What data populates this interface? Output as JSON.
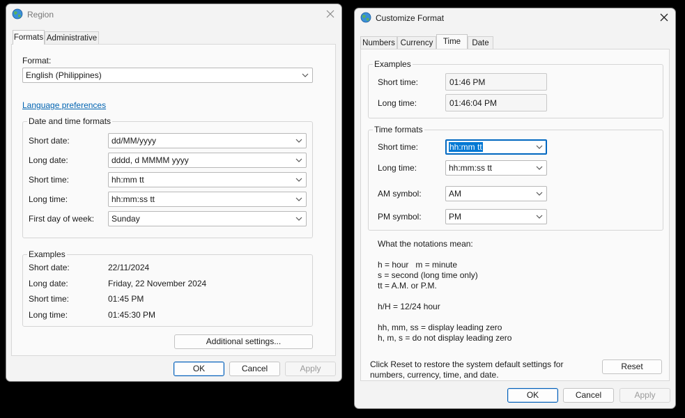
{
  "region": {
    "title": "Region",
    "tabs": [
      "Formats",
      "Administrative"
    ],
    "format_label": "Format:",
    "format_value": "English (Philippines)",
    "language_link": "Language preferences",
    "dt_group_title": "Date and time formats",
    "rows": [
      {
        "label": "Short date:",
        "value": "dd/MM/yyyy"
      },
      {
        "label": "Long date:",
        "value": "dddd, d MMMM yyyy"
      },
      {
        "label": "Short time:",
        "value": "hh:mm tt"
      },
      {
        "label": "Long time:",
        "value": "hh:mm:ss tt"
      },
      {
        "label": "First day of week:",
        "value": "Sunday"
      }
    ],
    "examples_title": "Examples",
    "examples": [
      {
        "label": "Short date:",
        "value": "22/11/2024"
      },
      {
        "label": "Long date:",
        "value": "Friday, 22 November 2024"
      },
      {
        "label": "Short time:",
        "value": "01:45 PM"
      },
      {
        "label": "Long time:",
        "value": "01:45:30 PM"
      }
    ],
    "additional_btn": "Additional settings...",
    "ok": "OK",
    "cancel": "Cancel",
    "apply": "Apply"
  },
  "customize": {
    "title": "Customize Format",
    "tabs": [
      "Numbers",
      "Currency",
      "Time",
      "Date"
    ],
    "examples_title": "Examples",
    "examples": [
      {
        "label": "Short time:",
        "value": "01:46 PM"
      },
      {
        "label": "Long time:",
        "value": "01:46:04 PM"
      }
    ],
    "formats_title": "Time formats",
    "formats": [
      {
        "label": "Short time:",
        "value": "hh:mm tt"
      },
      {
        "label": "Long time:",
        "value": "hh:mm:ss tt"
      },
      {
        "label": "AM symbol:",
        "value": "AM"
      },
      {
        "label": "PM symbol:",
        "value": "PM"
      }
    ],
    "notes": {
      "heading": "What the notations mean:",
      "line1": "h = hour   m = minute",
      "line2": "s = second (long time only)",
      "line3": "tt = A.M. or P.M.",
      "line4": "h/H = 12/24 hour",
      "line5": "hh, mm, ss = display leading zero",
      "line6": "h, m, s = do not display leading zero"
    },
    "reset_text_1": "Click Reset to restore the system default settings for",
    "reset_text_2": "numbers, currency, time, and date.",
    "reset_btn": "Reset",
    "ok": "OK",
    "cancel": "Cancel",
    "apply": "Apply"
  },
  "icons": {
    "globe": "globe-icon",
    "close": "close-icon",
    "chevron": "chevron-down-icon"
  }
}
